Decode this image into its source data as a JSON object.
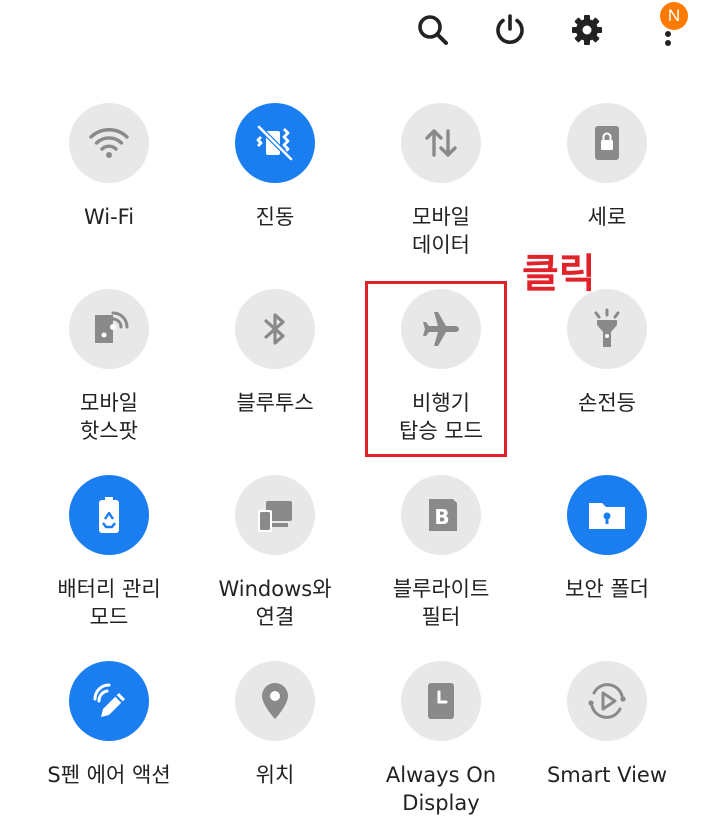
{
  "colors": {
    "active": "#1a7df0",
    "inactive_bg": "#e8e8e8",
    "inactive_icon": "#8a8a8a",
    "badge": "#ff7a00",
    "annotation": "#e0232b",
    "text": "#222222"
  },
  "topbar": {
    "search_icon": "search-icon",
    "power_icon": "power-icon",
    "settings_icon": "gear-icon",
    "more_icon": "more-vertical-icon",
    "badge_text": "N"
  },
  "tiles": [
    {
      "label": "Wi-Fi",
      "icon": "wifi-icon",
      "active": false
    },
    {
      "label": "진동",
      "icon": "vibrate-icon",
      "active": true
    },
    {
      "label": "모바일\n데이터",
      "icon": "mobile-data-icon",
      "active": false
    },
    {
      "label": "세로",
      "icon": "portrait-lock-icon",
      "active": false
    },
    {
      "label": "모바일\n핫스팟",
      "icon": "hotspot-icon",
      "active": false
    },
    {
      "label": "블루투스",
      "icon": "bluetooth-icon",
      "active": false
    },
    {
      "label": "비행기\n탑승 모드",
      "icon": "airplane-icon",
      "active": false
    },
    {
      "label": "손전등",
      "icon": "flashlight-icon",
      "active": false
    },
    {
      "label": "배터리 관리\n모드",
      "icon": "battery-saver-icon",
      "active": true
    },
    {
      "label": "Windows와\n연결",
      "icon": "link-to-windows-icon",
      "active": false
    },
    {
      "label": "블루라이트\n필터",
      "icon": "blue-light-filter-icon",
      "active": false
    },
    {
      "label": "보안 폴더",
      "icon": "secure-folder-icon",
      "active": true
    },
    {
      "label": "S펜 에어 액션",
      "icon": "s-pen-icon",
      "active": true
    },
    {
      "label": "위치",
      "icon": "location-icon",
      "active": false
    },
    {
      "label": "Always On\nDisplay",
      "icon": "always-on-display-icon",
      "active": false
    },
    {
      "label": "Smart View",
      "icon": "smart-view-icon",
      "active": false
    }
  ],
  "annotation": {
    "text": "클릭"
  }
}
